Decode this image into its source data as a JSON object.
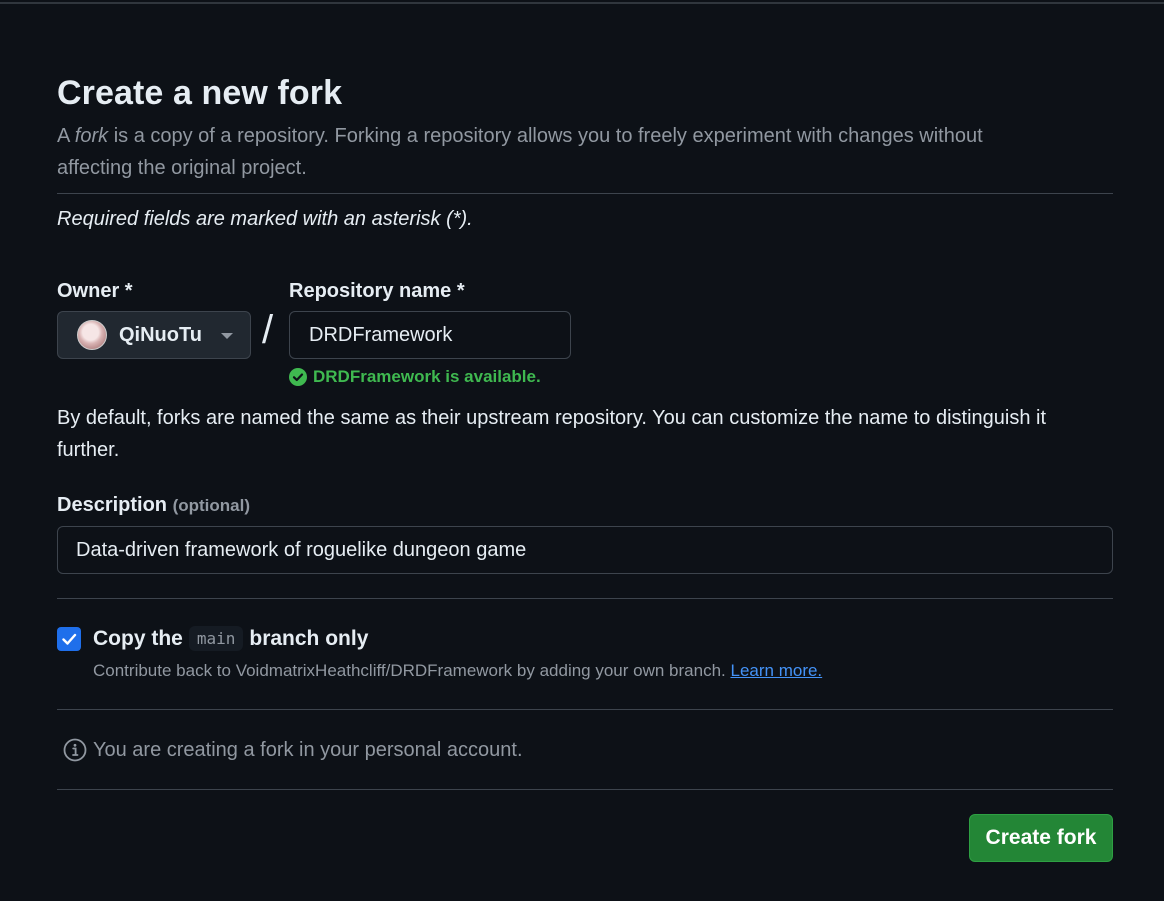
{
  "header": {
    "title": "Create a new fork",
    "subtitle_prefix": "A ",
    "subtitle_emph": "fork",
    "subtitle_rest": " is a copy of a repository. Forking a repository allows you to freely experiment with changes without affecting the original project."
  },
  "required_note": "Required fields are marked with an asterisk (*).",
  "owner": {
    "label": "Owner *",
    "value": "QiNuoTu",
    "separator": "/"
  },
  "repository": {
    "label": "Repository name *",
    "value": "DRDFramework",
    "availability": "DRDFramework is available."
  },
  "naming_hint": "By default, forks are named the same as their upstream repository. You can customize the name to distinguish it further.",
  "description": {
    "label": "Description",
    "optional": "(optional)",
    "value": "Data-driven framework of roguelike dungeon game"
  },
  "copy_branch": {
    "checked": true,
    "label_prefix": "Copy the",
    "branch": "main",
    "label_suffix": "branch only",
    "subtext": "Contribute back to VoidmatrixHeathcliff/DRDFramework by adding your own branch.",
    "learn_more": "Learn more."
  },
  "info_text": "You are creating a fork in your personal account.",
  "submit_label": "Create fork",
  "colors": {
    "background": "#0d1117",
    "accent_green": "#238636",
    "success": "#3fb950",
    "link": "#4493f8",
    "checkbox": "#1f6feb"
  }
}
